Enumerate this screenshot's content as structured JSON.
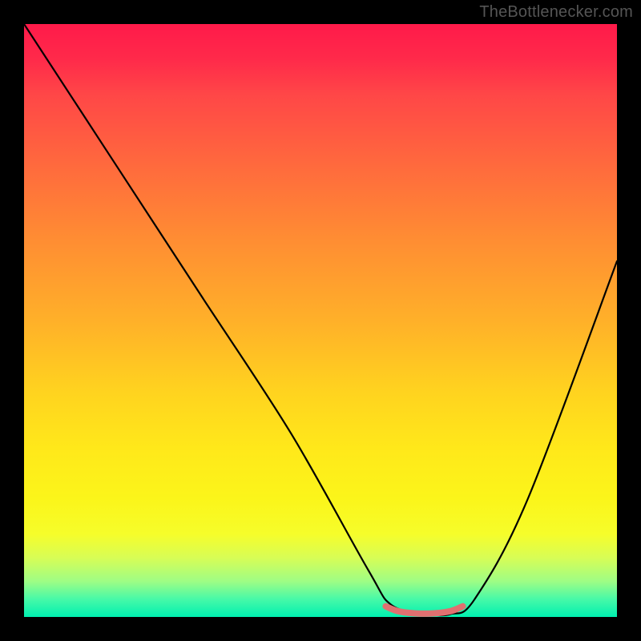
{
  "attribution": "TheBottlenecker.com",
  "chart_data": {
    "type": "line",
    "title": "",
    "xlabel": "",
    "ylabel": "",
    "xlim": [
      0,
      100
    ],
    "ylim": [
      0,
      100
    ],
    "series": [
      {
        "name": "bottleneck-curve",
        "x": [
          0,
          15,
          30,
          45,
          58,
          62,
          68,
          72,
          76,
          85,
          100
        ],
        "y": [
          100,
          77,
          54,
          31,
          8,
          2,
          0.5,
          0.5,
          3,
          20,
          60
        ],
        "color": "#000000"
      },
      {
        "name": "optimal-segment",
        "x": [
          61,
          63,
          66,
          69,
          72,
          74
        ],
        "y": [
          1.8,
          1.0,
          0.6,
          0.6,
          1.0,
          1.8
        ],
        "color": "#e07070"
      }
    ],
    "gradient_stops": [
      {
        "pos": 0,
        "color": "#ff1a4a"
      },
      {
        "pos": 50,
        "color": "#ffb029"
      },
      {
        "pos": 80,
        "color": "#fbf51a"
      },
      {
        "pos": 100,
        "color": "#00f0b0"
      }
    ]
  }
}
